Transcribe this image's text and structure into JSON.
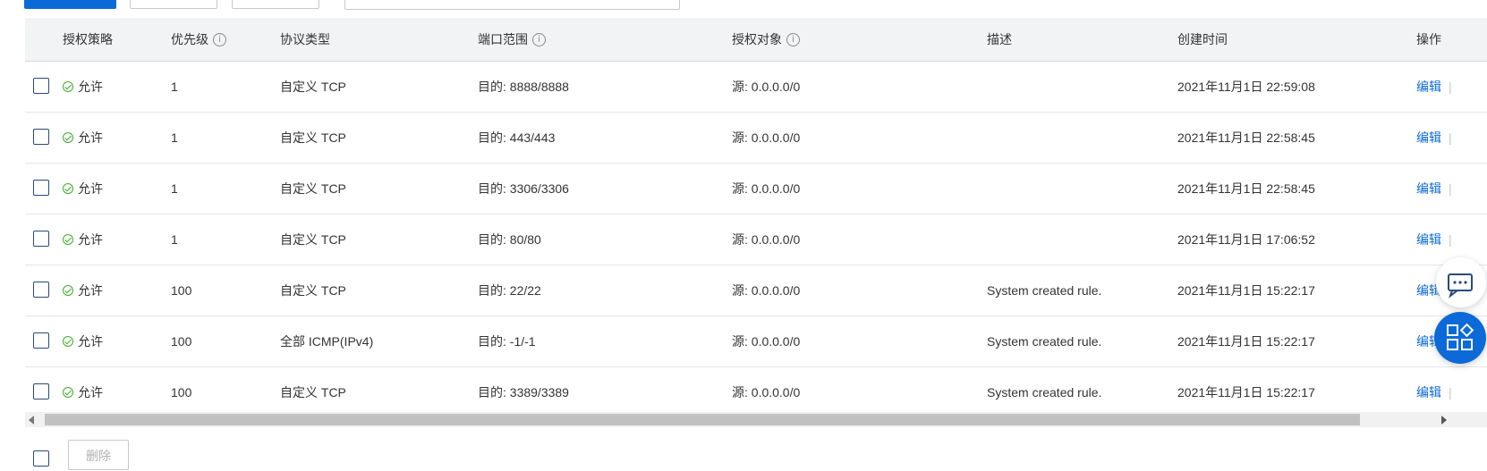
{
  "table": {
    "headers": {
      "policy": "授权策略",
      "priority": "优先级",
      "protocol": "协议类型",
      "port_range": "端口范围",
      "target": "授权对象",
      "description": "描述",
      "created": "创建时间",
      "actions": "操作"
    },
    "info_icon_glyph": "i",
    "rows": [
      {
        "policy": "允许",
        "priority": "1",
        "protocol": "自定义 TCP",
        "port": "目的: 8888/8888",
        "target": "源: 0.0.0.0/0",
        "description": "",
        "created": "2021年11月1日 22:59:08",
        "edit": "编辑"
      },
      {
        "policy": "允许",
        "priority": "1",
        "protocol": "自定义 TCP",
        "port": "目的: 443/443",
        "target": "源: 0.0.0.0/0",
        "description": "",
        "created": "2021年11月1日 22:58:45",
        "edit": "编辑"
      },
      {
        "policy": "允许",
        "priority": "1",
        "protocol": "自定义 TCP",
        "port": "目的: 3306/3306",
        "target": "源: 0.0.0.0/0",
        "description": "",
        "created": "2021年11月1日 22:58:45",
        "edit": "编辑"
      },
      {
        "policy": "允许",
        "priority": "1",
        "protocol": "自定义 TCP",
        "port": "目的: 80/80",
        "target": "源: 0.0.0.0/0",
        "description": "",
        "created": "2021年11月1日 17:06:52",
        "edit": "编辑"
      },
      {
        "policy": "允许",
        "priority": "100",
        "protocol": "自定义 TCP",
        "port": "目的: 22/22",
        "target": "源: 0.0.0.0/0",
        "description": "System created rule.",
        "created": "2021年11月1日 15:22:17",
        "edit": "编辑"
      },
      {
        "policy": "允许",
        "priority": "100",
        "protocol": "全部 ICMP(IPv4)",
        "port": "目的: -1/-1",
        "target": "源: 0.0.0.0/0",
        "description": "System created rule.",
        "created": "2021年11月1日 15:22:17",
        "edit": "编辑"
      },
      {
        "policy": "允许",
        "priority": "100",
        "protocol": "自定义 TCP",
        "port": "目的: 3389/3389",
        "target": "源: 0.0.0.0/0",
        "description": "System created rule.",
        "created": "2021年11月1日 15:22:17",
        "edit": "编辑"
      }
    ]
  },
  "footer": {
    "delete_label": "删除"
  },
  "colors": {
    "accent": "#0b6ad8",
    "allow_green": "#3dae2b",
    "header_bg": "#f2f3f5"
  }
}
